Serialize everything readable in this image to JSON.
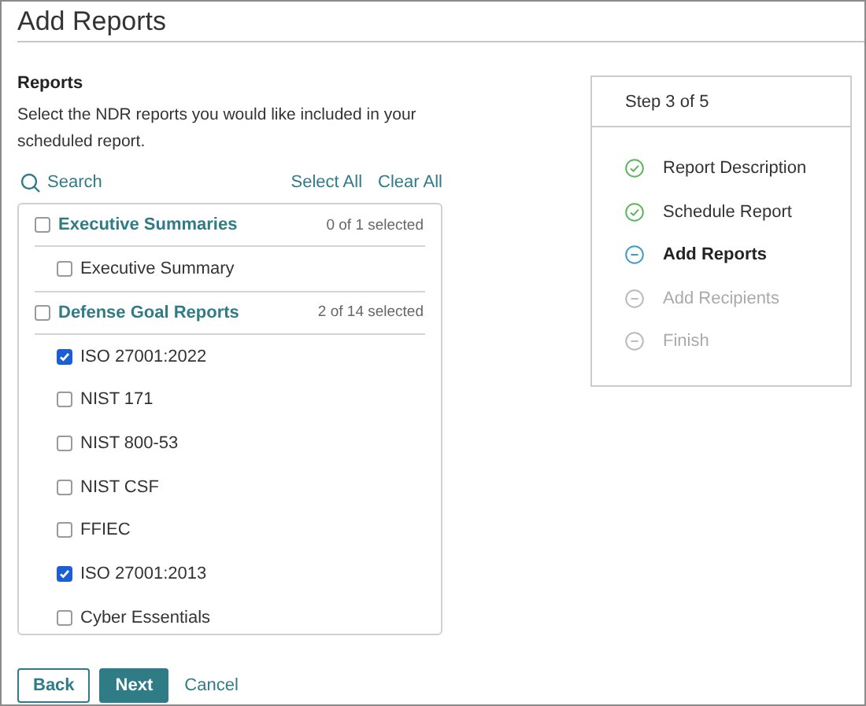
{
  "title": "Add Reports",
  "section": {
    "heading": "Reports",
    "description": "Select the NDR reports you would like included in your scheduled report."
  },
  "toolbar": {
    "search": "Search",
    "select_all": "Select All",
    "clear_all": "Clear All"
  },
  "groups": [
    {
      "label": "Executive Summaries",
      "count": "0 of 1 selected",
      "checked": false,
      "items": [
        {
          "label": "Executive Summary",
          "checked": false
        }
      ]
    },
    {
      "label": "Defense Goal Reports",
      "count": "2 of 14 selected",
      "checked": false,
      "items": [
        {
          "label": "ISO 27001:2022",
          "checked": true
        },
        {
          "label": "NIST 171",
          "checked": false
        },
        {
          "label": "NIST 800-53",
          "checked": false
        },
        {
          "label": "NIST CSF",
          "checked": false
        },
        {
          "label": "FFIEC",
          "checked": false
        },
        {
          "label": "ISO 27001:2013",
          "checked": true
        },
        {
          "label": "Cyber Essentials",
          "checked": false
        }
      ]
    }
  ],
  "buttons": {
    "back": "Back",
    "next": "Next",
    "cancel": "Cancel"
  },
  "steps_panel": {
    "header": "Step 3 of 5",
    "steps": [
      {
        "label": "Report Description",
        "completed": true,
        "current": false
      },
      {
        "label": "Schedule Report",
        "completed": true,
        "current": false
      },
      {
        "label": "Add Reports",
        "completed": false,
        "current": true
      },
      {
        "label": "Add Recipients",
        "completed": false,
        "current": false
      },
      {
        "label": "Finish",
        "completed": false,
        "current": false
      }
    ]
  }
}
